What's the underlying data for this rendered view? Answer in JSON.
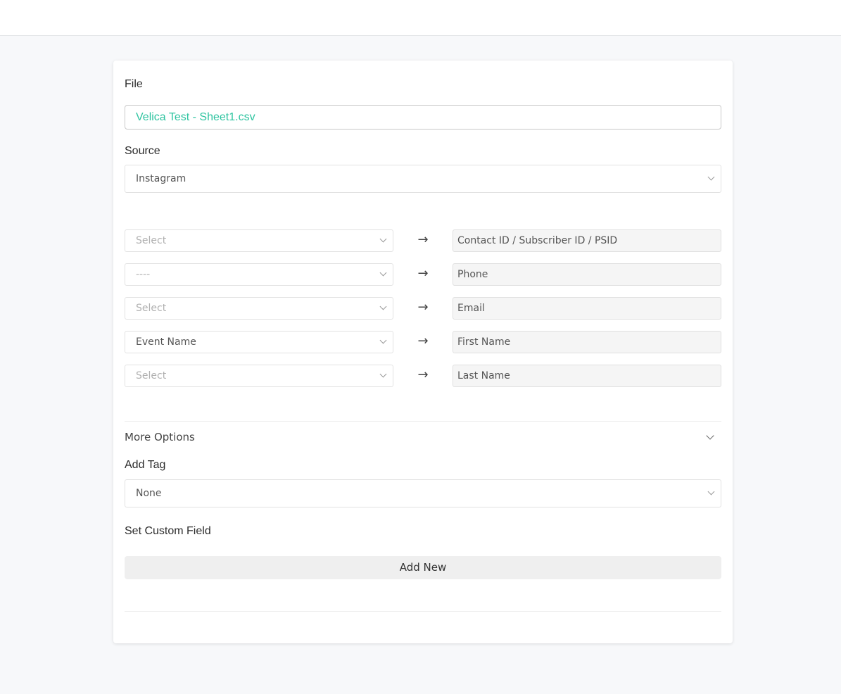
{
  "form": {
    "file_label": "File",
    "file_name": "Velica Test - Sheet1.csv",
    "source_label": "Source",
    "source_value": "Instagram",
    "mappings": [
      {
        "select": "Select",
        "placeholder": true,
        "target": "Contact ID / Subscriber ID / PSID"
      },
      {
        "select": "----",
        "placeholder": true,
        "target": "Phone"
      },
      {
        "select": "Select",
        "placeholder": true,
        "target": "Email"
      },
      {
        "select": "Event Name",
        "placeholder": false,
        "target": "First Name"
      },
      {
        "select": "Select",
        "placeholder": true,
        "target": "Last Name"
      }
    ],
    "arrow_glyph": "→",
    "more_options_label": "More Options",
    "add_tag_label": "Add Tag",
    "add_tag_value": "None",
    "custom_field_label": "Set Custom Field",
    "add_new_label": "Add New"
  },
  "colors": {
    "file_text": "#2ec4a0",
    "page_bg": "#f7f8fa"
  },
  "icons": {
    "dropdown": "chevron-down-icon",
    "mapping": "arrow-right-icon"
  }
}
